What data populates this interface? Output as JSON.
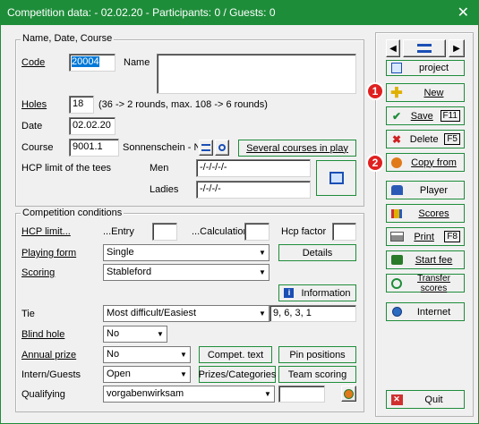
{
  "window": {
    "title": "Competition data:  - 02.02.20 - Participants: 0 / Guests: 0",
    "close_glyph": "✕"
  },
  "general": {
    "group_label": "Name, Date, Course",
    "code_label": "Code",
    "code_value": "20004",
    "name_label": "Name",
    "name_value": "",
    "holes_label": "Holes",
    "holes_value": "18",
    "holes_hint": "(36 -> 2 rounds, max. 108 -> 6 rounds)",
    "date_label": "Date",
    "date_value": "02.02.20",
    "course_label": "Course",
    "course_value": "9001.1",
    "course_name": "Sonnenschein - N",
    "several_courses_label": "Several courses in play",
    "hcp_limit_label": "HCP limit of the tees",
    "men_label": "Men",
    "men_value": "-/-/-/-/-",
    "ladies_label": "Ladies",
    "ladies_value": "-/-/-/-"
  },
  "conditions": {
    "group_label": "Competition conditions",
    "hcp_limit_label": "HCP limit...",
    "entry_label": "...Entry",
    "entry_value": "",
    "calculation_label": "...Calculation",
    "calculation_value": "",
    "hcp_factor_label": "Hcp factor",
    "hcp_factor_value": "",
    "playing_form_label": "Playing form",
    "playing_form_value": "Single",
    "details_label": "Details",
    "scoring_label": "Scoring",
    "scoring_value": "Stableford",
    "information_label": "Information",
    "tie_label": "Tie",
    "tie_value": "Most difficult/Easiest",
    "tie_holes": "9, 6, 3, 1",
    "blind_hole_label": "Blind hole",
    "blind_hole_value": "No",
    "annual_prize_label": "Annual prize",
    "annual_prize_value": "No",
    "compet_text_label": "Compet. text",
    "pin_positions_label": "Pin positions",
    "intern_guests_label": "Intern/Guests",
    "intern_guests_value": "Open",
    "prizes_label": "Prizes/Categories",
    "team_scoring_label": "Team scoring",
    "qualifying_label": "Qualifying",
    "qualifying_value": "vorgabenwirksam",
    "qualifying_extra": ""
  },
  "sidebar": {
    "project_label": "project",
    "new_label": "New",
    "save_label": "Save",
    "save_key": "F11",
    "delete_label": "Delete",
    "delete_key": "F5",
    "copy_from_label": "Copy from",
    "player_label": "Player",
    "scores_label": "Scores",
    "print_label": "Print",
    "print_key": "F8",
    "start_fee_label": "Start fee",
    "transfer_scores_label": "Transfer scores",
    "internet_label": "Internet",
    "quit_label": "Quit"
  },
  "badges": {
    "one": "1",
    "two": "2"
  },
  "colors": {
    "accent": "#1e8d3a",
    "badge": "#e02020",
    "selection": "#0078d7"
  }
}
